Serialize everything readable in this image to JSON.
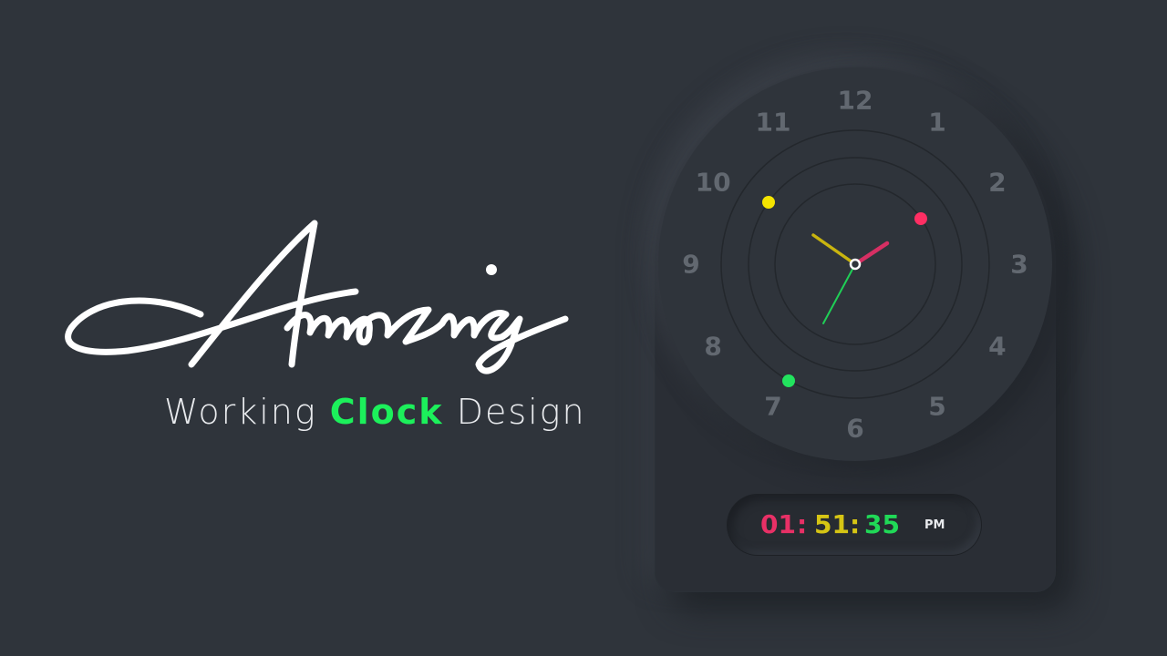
{
  "headline": {
    "script_word": "Amazing",
    "subtitle_part1": "Working",
    "subtitle_accent": "Clock",
    "subtitle_part3": "Design"
  },
  "clock": {
    "numerals": [
      "12",
      "1",
      "2",
      "3",
      "4",
      "5",
      "6",
      "7",
      "8",
      "9",
      "10",
      "11"
    ],
    "digital": {
      "hours": "01",
      "sep1": ":",
      "minutes": "51",
      "sep2": ":",
      "seconds": "35",
      "ampm": "PM"
    },
    "hand_colors": {
      "hour": "#ff2e63",
      "minute": "#f0e000",
      "second": "#1ee35c"
    }
  },
  "colors": {
    "background": "#2f343b",
    "accent_green": "#1cf05b",
    "hours_color": "#e83066",
    "minutes_color": "#d6c514",
    "seconds_color": "#20d957"
  }
}
